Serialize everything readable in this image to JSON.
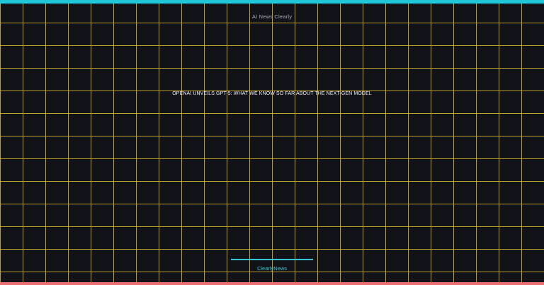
{
  "header": {
    "site_name": "AI News Clearly"
  },
  "article": {
    "headline": "OPENAI UNVEILS GPT-5: WHAT WE KNOW SO FAR ABOUT THE NEXT-GEN MODEL"
  },
  "footer": {
    "brand": "ClearlyNews"
  },
  "colors": {
    "background": "#121319",
    "grid_line": "#e2c12a",
    "top_accent": "#1ec8d6",
    "bottom_accent": "#e86f6f",
    "footer_accent": "#34c6d3"
  }
}
